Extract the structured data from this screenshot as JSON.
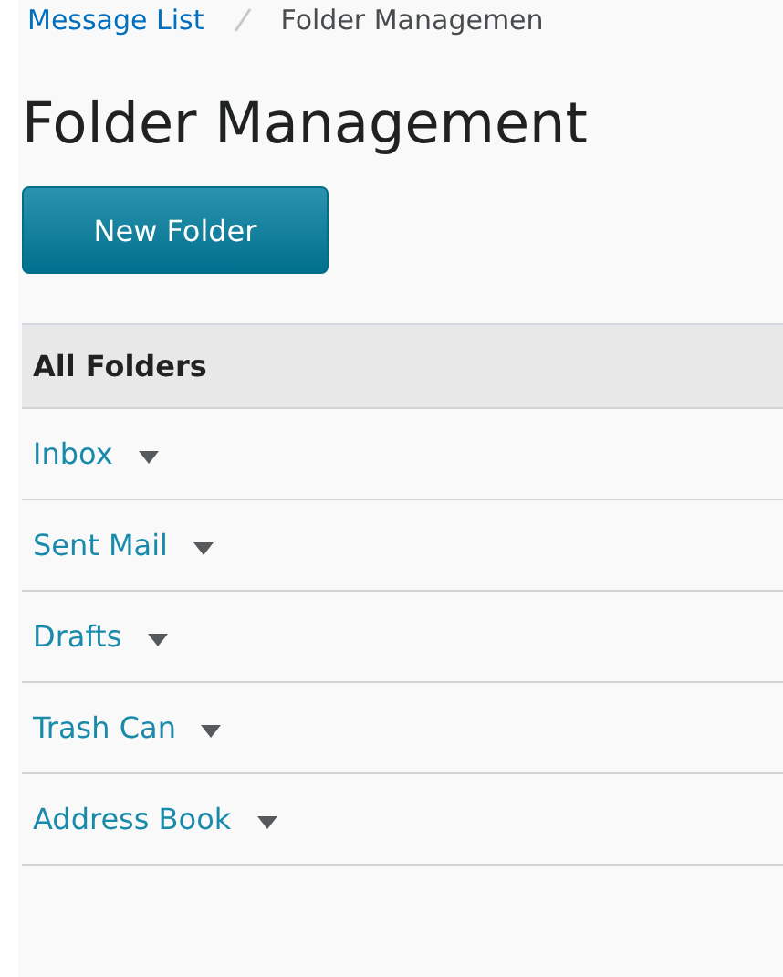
{
  "breadcrumbs": [
    {
      "label": "Message List"
    },
    {
      "label": "Folder Managemen"
    }
  ],
  "page_title": "Folder Management",
  "new_folder_button": "New Folder",
  "table": {
    "header": "All Folders",
    "rows": [
      {
        "label": "Inbox"
      },
      {
        "label": "Sent Mail"
      },
      {
        "label": "Drafts"
      },
      {
        "label": "Trash Can"
      },
      {
        "label": "Address Book"
      }
    ]
  }
}
